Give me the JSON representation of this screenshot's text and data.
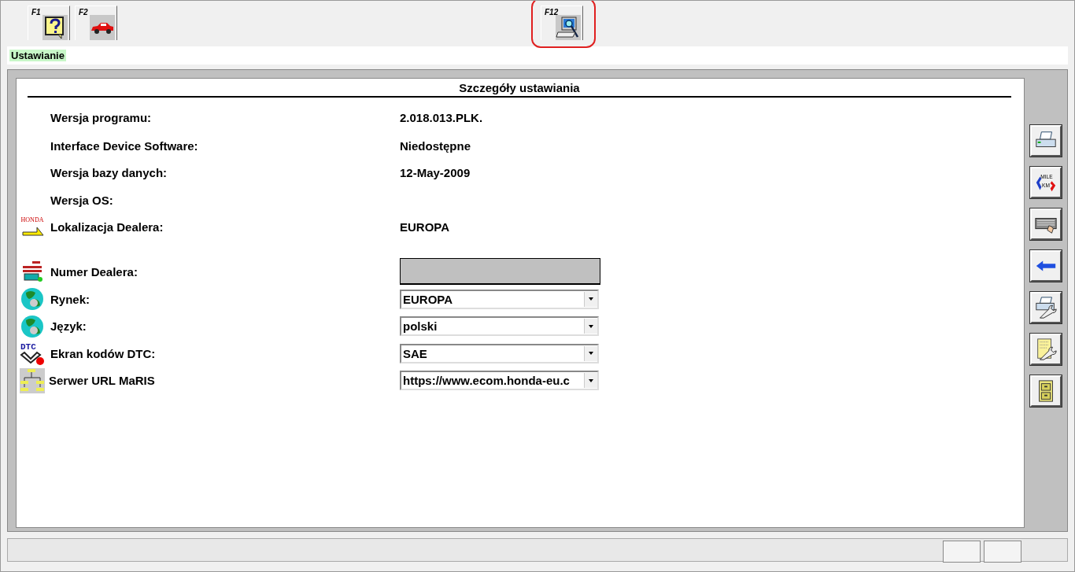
{
  "function_keys": [
    {
      "key": "F1",
      "kind": "help",
      "highlighted": false
    },
    {
      "key": "F2",
      "kind": "car",
      "highlighted": false
    },
    {
      "key": "F12",
      "kind": "computer",
      "highlighted": true
    }
  ],
  "breadcrumb": "Ustawianie",
  "panel": {
    "title": "Szczegóły ustawiania",
    "rows": [
      {
        "label": "Wersja programu:",
        "kind": "text",
        "value": "2.018.013.PLK."
      },
      {
        "label": "Interface Device Software:",
        "kind": "text",
        "value": "Niedostępne"
      },
      {
        "label": "Wersja bazy danych:",
        "kind": "text",
        "value": "12-May-2009"
      },
      {
        "label": "Wersja OS:",
        "kind": "text"
      },
      {
        "label": "Lokalizacja Dealera:",
        "kind": "text",
        "value": "EUROPA",
        "icon_text": "HONDA"
      },
      {
        "label": "Numer Dealera:",
        "kind": "field"
      },
      {
        "label": "Rynek:",
        "kind": "dropdown",
        "value": "EUROPA"
      },
      {
        "label": "Język:",
        "kind": "dropdown",
        "value": "polski"
      },
      {
        "label": "Ekran kodów DTC:",
        "kind": "dropdown",
        "value": "SAE",
        "icon_text": "DTC"
      },
      {
        "label": "Serwer URL MaRIS",
        "kind": "dropdown",
        "value": "https://www.ecom.honda-eu.c"
      }
    ]
  },
  "side_buttons": [
    {
      "kind": "printer"
    },
    {
      "kind": "units",
      "icon_text": [
        "MILE",
        "KM"
      ]
    },
    {
      "kind": "keyboard"
    },
    {
      "kind": "back"
    },
    {
      "kind": "printer-wrench"
    },
    {
      "kind": "notes-wrench"
    },
    {
      "kind": "cabinet"
    }
  ]
}
